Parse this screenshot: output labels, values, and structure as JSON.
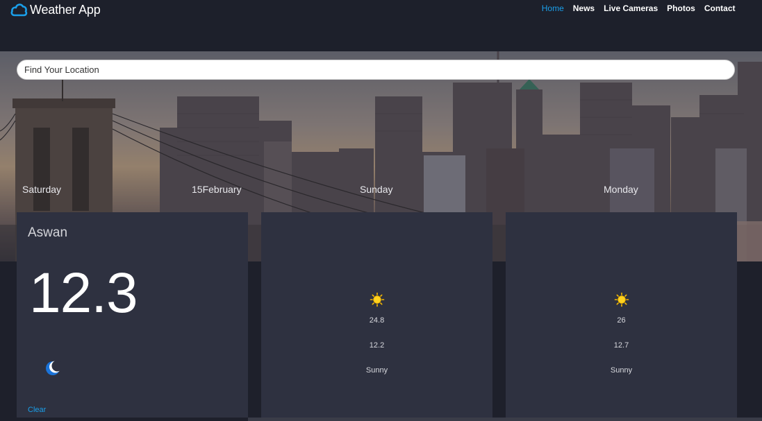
{
  "app": {
    "title": "Weather App",
    "logo_icon": "cloud-icon",
    "accent_color": "#1a9fea"
  },
  "nav": {
    "items": [
      {
        "label": "Home",
        "active": true
      },
      {
        "label": "News",
        "active": false
      },
      {
        "label": "Live Cameras",
        "active": false
      },
      {
        "label": "Photos",
        "active": false
      },
      {
        "label": "Contact",
        "active": false
      }
    ]
  },
  "search": {
    "placeholder": "Find Your Location",
    "value": ""
  },
  "today": {
    "day": "Saturday",
    "date": "15February",
    "city": "Aswan",
    "temperature": "12.3",
    "icon": "moon-icon",
    "condition": "Clear"
  },
  "forecast": [
    {
      "day": "Sunday",
      "icon": "sun-icon",
      "max": "24.8",
      "min": "12.2",
      "condition": "Sunny"
    },
    {
      "day": "Monday",
      "icon": "sun-icon",
      "max": "26",
      "min": "12.7",
      "condition": "Sunny"
    }
  ]
}
